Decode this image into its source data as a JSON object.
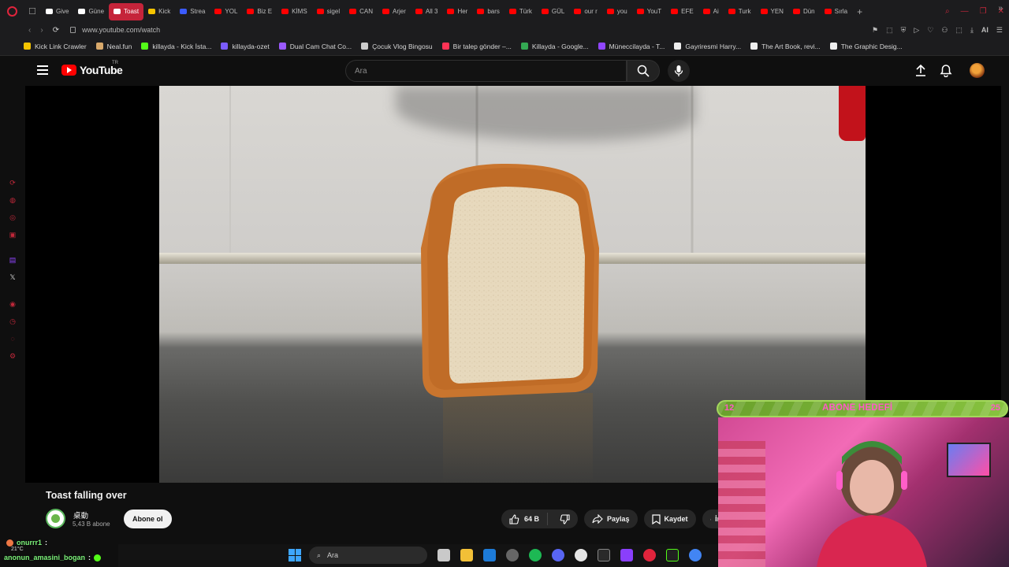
{
  "browser": {
    "tabs": [
      {
        "label": "Give",
        "color": "#ffffff"
      },
      {
        "label": "Güne",
        "color": "#ffffff"
      },
      {
        "label": "Toast",
        "color": "#ff0000",
        "active": true
      },
      {
        "label": "Kick",
        "color": "#f5c400"
      },
      {
        "label": "Strea",
        "color": "#3b5bff"
      },
      {
        "label": "YOL",
        "color": "#ff0000"
      },
      {
        "label": "Biz E",
        "color": "#ff0000"
      },
      {
        "label": "KİMS",
        "color": "#ff0000"
      },
      {
        "label": "sigel",
        "color": "#ff0000"
      },
      {
        "label": "CAN",
        "color": "#ff0000"
      },
      {
        "label": "Arjer",
        "color": "#ff0000"
      },
      {
        "label": "All 3",
        "color": "#ff0000"
      },
      {
        "label": "Her",
        "color": "#ff0000"
      },
      {
        "label": "bars",
        "color": "#ff0000"
      },
      {
        "label": "Türk",
        "color": "#ff0000"
      },
      {
        "label": "GÜL",
        "color": "#ff0000"
      },
      {
        "label": "our r",
        "color": "#ff0000"
      },
      {
        "label": "you",
        "color": "#ff0000"
      },
      {
        "label": "YouT",
        "color": "#ff0000"
      },
      {
        "label": "EFE",
        "color": "#ff0000"
      },
      {
        "label": "Ai",
        "color": "#ff0000"
      },
      {
        "label": "Turk",
        "color": "#ff0000"
      },
      {
        "label": "YEN",
        "color": "#ff0000"
      },
      {
        "label": "Dün",
        "color": "#ff0000"
      },
      {
        "label": "Sırla",
        "color": "#ff0000"
      }
    ],
    "new_tab": "+",
    "url": "www.youtube.com/watch",
    "ai_label": "AI",
    "bookmarks": [
      {
        "label": "Kick Link Crawler",
        "color": "#f5c400"
      },
      {
        "label": "Neal.fun",
        "color": "#d9a96b"
      },
      {
        "label": "killayda - Kick İsta...",
        "color": "#53fc18"
      },
      {
        "label": "killayda-ozet",
        "color": "#7b5cff"
      },
      {
        "label": "Dual Cam Chat Co...",
        "color": "#9b59ff"
      },
      {
        "label": "Çocuk Vlog Bingosu",
        "color": "#cccccc"
      },
      {
        "label": "Bir talep gönder –...",
        "color": "#ff3355"
      },
      {
        "label": "Killayda - Google...",
        "color": "#34a853"
      },
      {
        "label": "Müneccilayda - T...",
        "color": "#9146ff"
      },
      {
        "label": "Gayriresmi Harry...",
        "color": "#eeeeee"
      },
      {
        "label": "The Art Book, revi...",
        "color": "#eeeeee"
      },
      {
        "label": "The Graphic Desig...",
        "color": "#eeeeee"
      }
    ]
  },
  "youtube": {
    "logo_text": "YouTube",
    "country_code": "TR",
    "search_placeholder": "Ara",
    "video": {
      "title": "Toast falling over",
      "channel_name": "桌動",
      "subscribers": "5,43 B abone",
      "subscribe_label": "Abone ol",
      "like_count": "64 B",
      "share_label": "Paylaş",
      "save_label": "Kaydet",
      "download_label": "İnd"
    }
  },
  "overlay": {
    "goal_current": "12",
    "goal_label": "ABONE HEDEFİ",
    "goal_target": "25",
    "chat": [
      {
        "user": "onurrr1",
        "message": ":"
      },
      {
        "user": "anonun_amasini_bogan",
        "message": ":"
      }
    ]
  },
  "taskbar": {
    "search_placeholder": "Ara",
    "weather": "21°C"
  }
}
